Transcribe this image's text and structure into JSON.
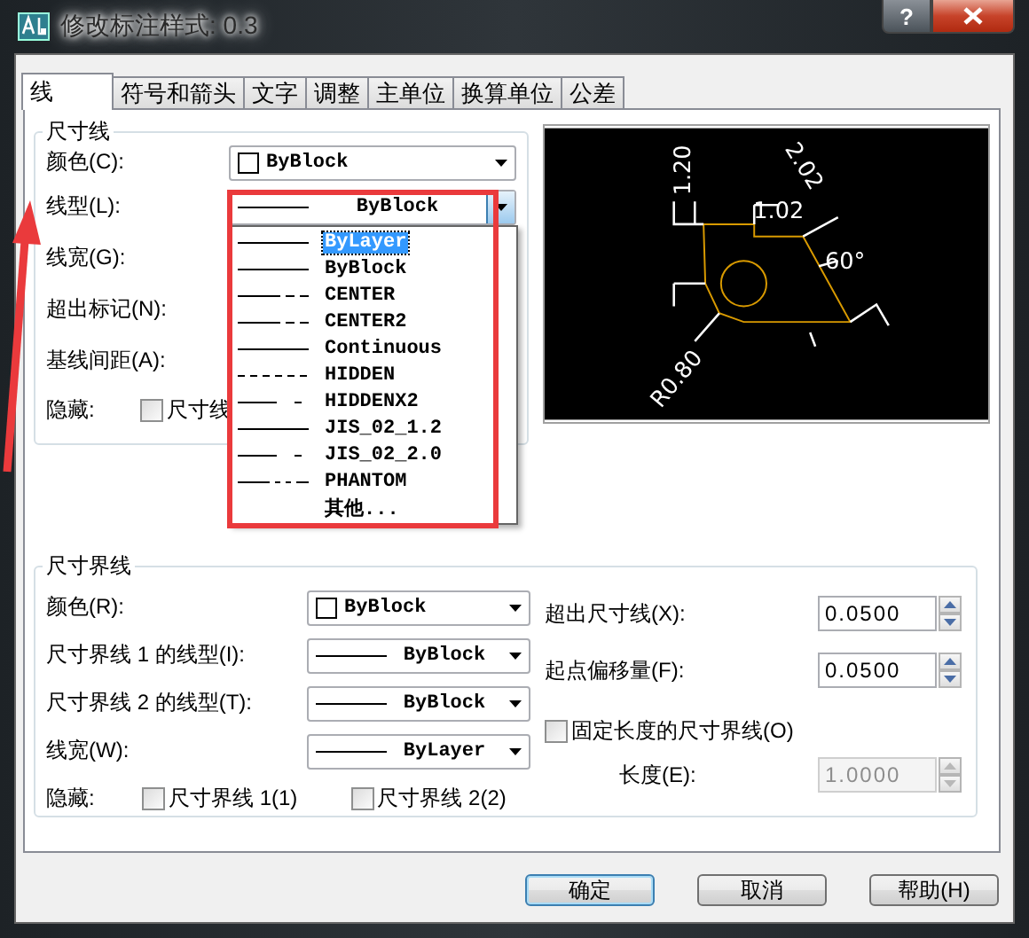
{
  "window": {
    "title": "修改标注样式: 0.3",
    "help": "?"
  },
  "tabs": [
    {
      "label": "线",
      "selected": true
    },
    {
      "label": "符号和箭头",
      "selected": false
    },
    {
      "label": "文字",
      "selected": false
    },
    {
      "label": "调整",
      "selected": false
    },
    {
      "label": "主单位",
      "selected": false
    },
    {
      "label": "换算单位",
      "selected": false
    },
    {
      "label": "公差",
      "selected": false
    }
  ],
  "dimension_lines": {
    "title": "尺寸线",
    "rows": [
      {
        "label": "颜色(C):",
        "combo": {
          "kind": "color",
          "value": "ByBlock",
          "expanded": false
        }
      },
      {
        "label": "线型(L):",
        "combo": {
          "kind": "line",
          "value": "ByBlock",
          "expanded": true
        }
      },
      {
        "label": "线宽(G):"
      },
      {
        "label": "超出标记(N):"
      },
      {
        "label": "基线间距(A):"
      }
    ],
    "hide": {
      "label": "隐藏:",
      "checkboxes": [
        {
          "label": "尺寸线",
          "checked": false
        }
      ]
    }
  },
  "linetype_list": [
    {
      "name": "ByLayer",
      "kind": "solid",
      "selected": true
    },
    {
      "name": "ByBlock",
      "kind": "solid",
      "selected": false
    },
    {
      "name": "CENTER",
      "kind": "center",
      "selected": false
    },
    {
      "name": "CENTER2",
      "kind": "center",
      "selected": false
    },
    {
      "name": "Continuous",
      "kind": "solid",
      "selected": false
    },
    {
      "name": "HIDDEN",
      "kind": "dashed",
      "selected": false
    },
    {
      "name": "HIDDENX2",
      "kind": "gap",
      "selected": false
    },
    {
      "name": "JIS_02_1.2",
      "kind": "solid",
      "selected": false
    },
    {
      "name": "JIS_02_2.0",
      "kind": "gap",
      "selected": false
    },
    {
      "name": "PHANTOM",
      "kind": "phantom",
      "selected": false
    },
    {
      "name": "其他...",
      "kind": "none",
      "selected": false
    }
  ],
  "preview": {
    "labels": [
      "1.20",
      "1.02",
      "2.02",
      "60°",
      "R0.80"
    ]
  },
  "extension_lines": {
    "title": "尺寸界线",
    "rows": [
      {
        "label": "颜色(R):",
        "combo": {
          "kind": "color",
          "value": "ByBlock",
          "expanded": false
        }
      },
      {
        "label": "尺寸界线 1 的线型(I):",
        "combo": {
          "kind": "line",
          "value": "ByBlock",
          "expanded": false
        }
      },
      {
        "label": "尺寸界线 2 的线型(T):",
        "combo": {
          "kind": "line",
          "value": "ByBlock",
          "expanded": false
        }
      },
      {
        "label": "线宽(W):",
        "combo": {
          "kind": "line",
          "value": "ByLayer",
          "expanded": false
        }
      }
    ],
    "hide": {
      "label": "隐藏:",
      "checkboxes": [
        {
          "label": "尺寸界线 1(1)",
          "checked": false
        },
        {
          "label": "尺寸界线 2(2)",
          "checked": false
        }
      ]
    },
    "fields": [
      {
        "label": "超出尺寸线(X):",
        "value": "0.0500",
        "disabled": false
      },
      {
        "label": "起点偏移量(F):",
        "value": "0.0500",
        "disabled": false
      }
    ],
    "fixed_length": {
      "label": "固定长度的尺寸界线(O)",
      "checked": false
    },
    "length": {
      "label": "长度(E):",
      "value": "1.0000",
      "disabled": true
    }
  },
  "buttons": [
    {
      "label": "确定",
      "default": true
    },
    {
      "label": "取消",
      "default": false
    },
    {
      "label": "帮助(H)",
      "default": false
    }
  ]
}
